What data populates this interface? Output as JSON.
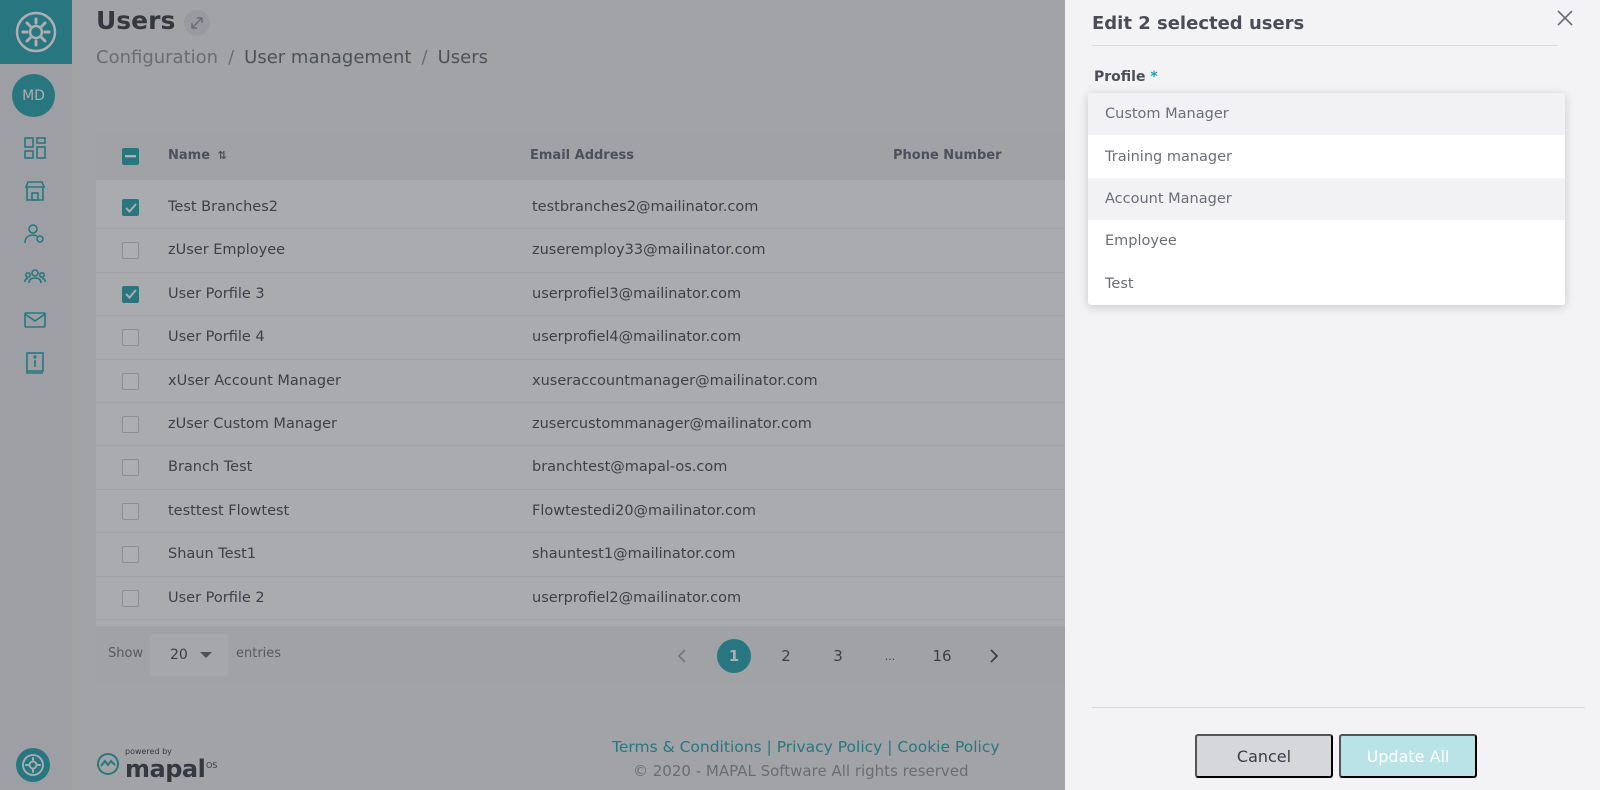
{
  "colors": {
    "accent": "#1aa1ab",
    "overlay": "rgba(60,62,68,0.42)"
  },
  "sidebar": {
    "avatar_initials": "MD",
    "icons": [
      "dashboard-icon",
      "store-icon",
      "user-settings-icon",
      "team-icon",
      "mail-icon",
      "info-book-icon"
    ]
  },
  "header": {
    "title": "Users",
    "breadcrumb": [
      "Configuration",
      "User management",
      "Users"
    ]
  },
  "table": {
    "columns": [
      "Name",
      "Email Address",
      "Phone Number"
    ],
    "rows": [
      {
        "name": "Test Branches2",
        "email": "testbranches2@mailinator.com",
        "checked": true
      },
      {
        "name": "zUser Employee",
        "email": "zuseremploy33@mailinator.com",
        "checked": false
      },
      {
        "name": "User Porfile 3",
        "email": "userprofiel3@mailinator.com",
        "checked": true
      },
      {
        "name": "User Porfile 4",
        "email": "userprofiel4@mailinator.com",
        "checked": false
      },
      {
        "name": "xUser Account Manager",
        "email": "xuseraccountmanager@mailinator.com",
        "checked": false
      },
      {
        "name": "zUser Custom Manager",
        "email": "zusercustommanager@mailinator.com",
        "checked": false
      },
      {
        "name": "Branch Test",
        "email": "branchtest@mapal-os.com",
        "checked": false
      },
      {
        "name": "testtest Flowtest",
        "email": "Flowtestedi20@mailinator.com",
        "checked": false
      },
      {
        "name": "Shaun Test1",
        "email": "shauntest1@mailinator.com",
        "checked": false
      },
      {
        "name": "User Porfile 2",
        "email": "userprofiel2@mailinator.com",
        "checked": false
      }
    ],
    "footer": {
      "show_label": "Show",
      "entries_value": "20",
      "entries_label": "entries",
      "pages": [
        "1",
        "2",
        "3",
        "...",
        "16"
      ],
      "current_page": "1"
    }
  },
  "footer": {
    "links": "Terms & Conditions | Privacy Policy | Cookie Policy",
    "copyright": "© 2020 - MAPAL Software All rights reserved",
    "powered_by": "powered by",
    "brand": "mapal",
    "brand_suffix": "OS"
  },
  "drawer": {
    "title": "Edit 2 selected users",
    "profile_label": "Profile",
    "required_mark": "*",
    "options": [
      "Custom Manager",
      "Training manager",
      "Account Manager",
      "Employee",
      "Test"
    ],
    "cancel_label": "Cancel",
    "update_label": "Update All"
  }
}
